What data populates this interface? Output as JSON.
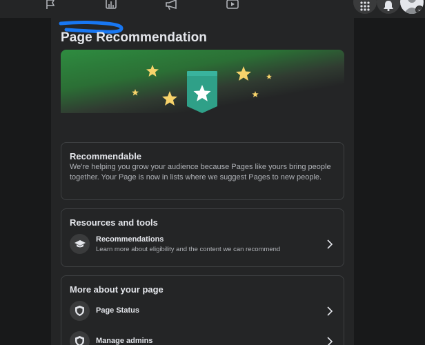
{
  "header": {
    "nav_icons": [
      "flag-icon",
      "insights-icon",
      "megaphone-icon",
      "video-icon"
    ],
    "right_icons": [
      "menu-grid-icon",
      "bell-icon",
      "avatar"
    ],
    "colors": {
      "bar": "#242526",
      "bg": "#18191a",
      "redaction": "#1877f2"
    }
  },
  "page": {
    "title": "Page Recommendation",
    "banner": {
      "colors": {
        "green": "#2e8c40",
        "badge": "#2fa088",
        "star": "#f7d36b"
      }
    }
  },
  "recommendable": {
    "title": "Recommendable",
    "description": "We're helping you grow your audience because Pages like yours bring people together. Your Page is now in lists where we suggest Pages to new people."
  },
  "resources": {
    "title": "Resources and tools",
    "items": [
      {
        "title": "Recommendations",
        "subtitle": "Learn more about eligibility and the content we can recommend",
        "icon": "graduation-cap-icon"
      }
    ]
  },
  "more": {
    "title": "More about your page",
    "items": [
      {
        "title": "Page Status",
        "icon": "shield-icon"
      },
      {
        "title": "Manage admins",
        "icon": "shield-icon"
      }
    ]
  }
}
